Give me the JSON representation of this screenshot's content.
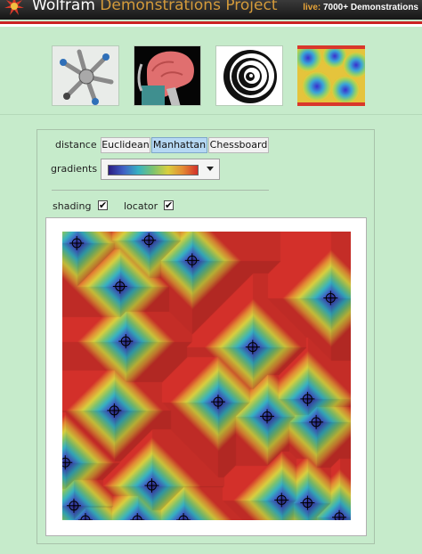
{
  "header": {
    "brand_primary": "Wolfram",
    "brand_secondary": "Demonstrations Project",
    "live_label": "live:",
    "live_count": "7000+ Demonstrations",
    "logo_icon": "spikey-star-icon",
    "colors": {
      "bar": "#1c1c1c",
      "accent": "#d39a3a",
      "rule": "#cc2323"
    }
  },
  "thumbnails": [
    {
      "name": "thumbnail-robot-arms",
      "selected": false
    },
    {
      "name": "thumbnail-brain-mri",
      "selected": false
    },
    {
      "name": "thumbnail-spiral",
      "selected": false
    },
    {
      "name": "thumbnail-voronoi",
      "selected": true
    }
  ],
  "controls": {
    "distance_label": "distance",
    "distance_options": [
      "Euclidean",
      "Manhattan",
      "Chessboard"
    ],
    "distance_selected": "Manhattan",
    "gradients_label": "gradients",
    "gradient_colors": [
      "#2b1d82",
      "#3f60c4",
      "#37b1c2",
      "#7cc36f",
      "#d9cf3e",
      "#e38a34",
      "#d3302a"
    ],
    "shading_label": "shading",
    "shading_checked": true,
    "locator_label": "locator",
    "locator_checked": true,
    "checkmark": "✔"
  },
  "voronoi_sites": [
    [
      0.05,
      0.04
    ],
    [
      0.3,
      0.03
    ],
    [
      0.45,
      0.1
    ],
    [
      0.2,
      0.19
    ],
    [
      0.93,
      0.23
    ],
    [
      0.22,
      0.38
    ],
    [
      0.66,
      0.4
    ],
    [
      0.54,
      0.59
    ],
    [
      0.85,
      0.58
    ],
    [
      0.18,
      0.62
    ],
    [
      0.71,
      0.64
    ],
    [
      0.88,
      0.66
    ],
    [
      0.01,
      0.8
    ],
    [
      0.31,
      0.88
    ],
    [
      0.76,
      0.93
    ],
    [
      0.04,
      0.95
    ],
    [
      0.85,
      0.94
    ],
    [
      0.08,
      1.0
    ],
    [
      0.26,
      1.0
    ],
    [
      0.42,
      1.0
    ],
    [
      0.96,
      0.99
    ]
  ]
}
